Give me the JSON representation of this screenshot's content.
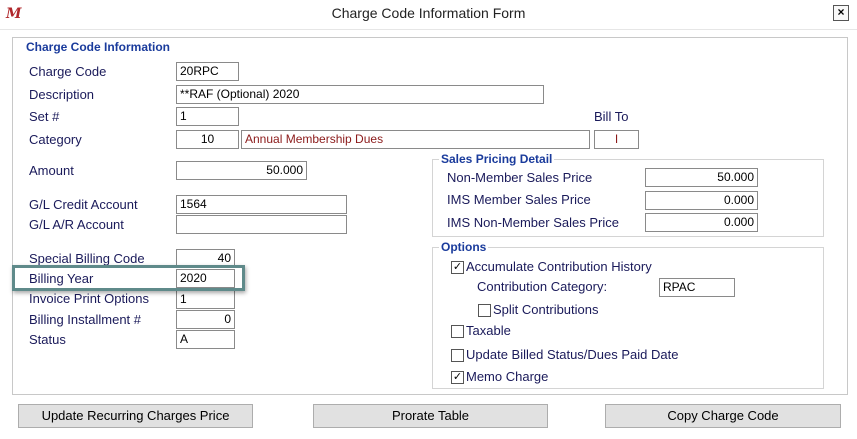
{
  "window": {
    "title": "Charge Code Information Form",
    "app_icon": "M",
    "close_glyph": "×"
  },
  "section_title": "Charge Code Information",
  "fields": {
    "charge_code": {
      "label": "Charge Code",
      "value": "20RPC"
    },
    "description": {
      "label": "Description",
      "value": "**RAF (Optional) 2020"
    },
    "set_number": {
      "label": "Set #",
      "value": "1"
    },
    "bill_to": {
      "label": "Bill To",
      "value": "I"
    },
    "category": {
      "label": "Category",
      "code": "10",
      "name": "Annual Membership Dues"
    },
    "amount": {
      "label": "Amount",
      "value": "50.000"
    },
    "gl_credit_account": {
      "label": "G/L Credit Account",
      "value": "1564"
    },
    "gl_ar_account": {
      "label": "G/L  A/R Account",
      "value": ""
    },
    "special_billing_code": {
      "label": "Special Billing Code",
      "value": "40"
    },
    "billing_year": {
      "label": "Billing Year",
      "value": "2020"
    },
    "invoice_print_options": {
      "label": "Invoice Print Options",
      "value": "1"
    },
    "billing_installment": {
      "label": "Billing Installment #",
      "value": "0"
    },
    "status": {
      "label": "Status",
      "value": "A"
    }
  },
  "sales_pricing": {
    "title": "Sales Pricing Detail",
    "non_member": {
      "label": "Non-Member Sales Price",
      "value": "50.000"
    },
    "ims_member": {
      "label": "IMS Member Sales Price",
      "value": "0.000"
    },
    "ims_non_member": {
      "label": "IMS Non-Member Sales Price",
      "value": "0.000"
    }
  },
  "options": {
    "title": "Options",
    "accumulate": {
      "label": "Accumulate Contribution History",
      "checked": true
    },
    "contribution_category": {
      "label": "Contribution Category:",
      "value": "RPAC"
    },
    "split": {
      "label": "Split Contributions",
      "checked": false
    },
    "taxable": {
      "label": "Taxable",
      "checked": false
    },
    "update_billed": {
      "label": "Update Billed Status/Dues Paid Date",
      "checked": false
    },
    "memo_charge": {
      "label": "Memo Charge",
      "checked": true
    }
  },
  "buttons": {
    "update_recurring": "Update Recurring Charges Price",
    "prorate": "Prorate Table",
    "copy": "Copy Charge Code"
  },
  "check_glyph": "✓"
}
